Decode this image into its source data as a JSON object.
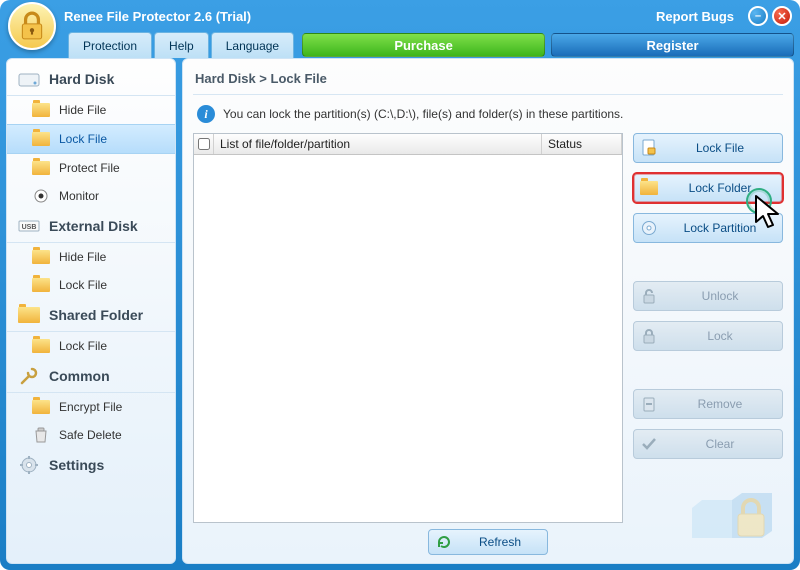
{
  "titlebar": {
    "app_title": "Renee File Protector 2.6 (Trial)",
    "report_bugs": "Report Bugs"
  },
  "menubar": {
    "protection": "Protection",
    "help": "Help",
    "language": "Language",
    "purchase": "Purchase",
    "register": "Register"
  },
  "sidebar": {
    "groups": [
      {
        "title": "Hard Disk",
        "items": [
          "Hide File",
          "Lock File",
          "Protect File",
          "Monitor"
        ]
      },
      {
        "title": "External Disk",
        "items": [
          "Hide File",
          "Lock File"
        ]
      },
      {
        "title": "Shared Folder",
        "items": [
          "Lock File"
        ]
      },
      {
        "title": "Common",
        "items": [
          "Encrypt File",
          "Safe Delete"
        ]
      },
      {
        "title": "Settings",
        "items": []
      }
    ]
  },
  "main": {
    "breadcrumb": "Hard Disk > Lock File",
    "info": "You can lock the partition(s) (C:\\,D:\\), file(s) and folder(s) in these partitions.",
    "columns": {
      "list": "List of file/folder/partition",
      "status": "Status"
    },
    "refresh": "Refresh"
  },
  "actions": {
    "lock_file": "Lock File",
    "lock_folder": "Lock Folder",
    "lock_partition": "Lock Partition",
    "unlock": "Unlock",
    "lock": "Lock",
    "remove": "Remove",
    "clear": "Clear"
  }
}
